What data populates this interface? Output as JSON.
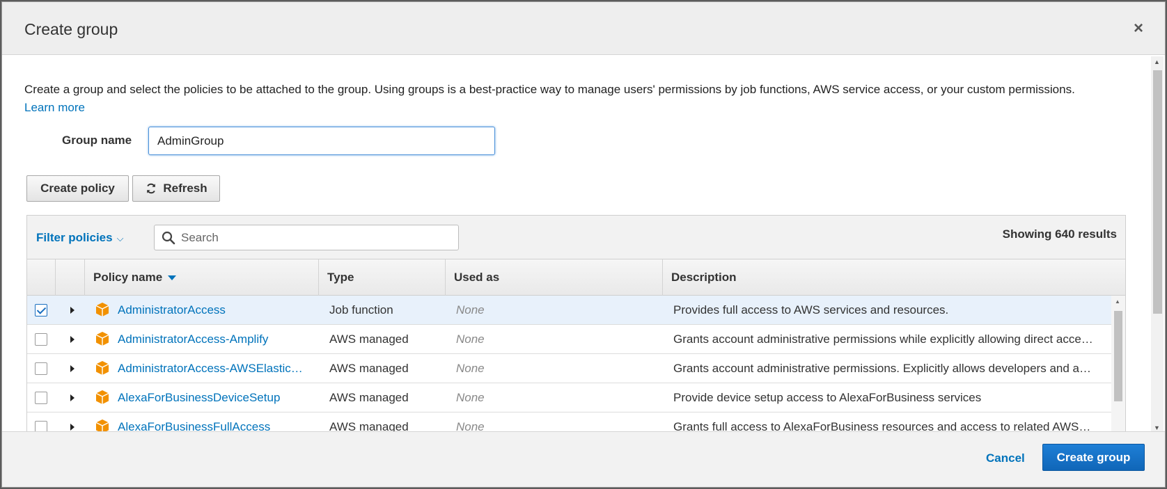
{
  "modal": {
    "title": "Create group",
    "close_symbol": "×"
  },
  "intro": {
    "text": "Create a group and select the policies to be attached to the group. Using groups is a best-practice way to manage users' permissions by job functions, AWS service access, or your custom permissions.",
    "learn_more": "Learn more"
  },
  "group_name": {
    "label": "Group name",
    "value": "AdminGroup"
  },
  "actions": {
    "create_policy": "Create policy",
    "refresh": "Refresh"
  },
  "filter": {
    "label": "Filter policies",
    "search_placeholder": "Search",
    "result_count": "Showing 640 results"
  },
  "table": {
    "columns": [
      "Policy name",
      "Type",
      "Used as",
      "Description"
    ],
    "rows": [
      {
        "name": "AdministratorAccess",
        "type": "Job function",
        "used_as": "None",
        "description": "Provides full access to AWS services and resources.",
        "checked": true
      },
      {
        "name": "AdministratorAccess-Amplify",
        "type": "AWS managed",
        "used_as": "None",
        "description": "Grants account administrative permissions while explicitly allowing direct acce…",
        "checked": false
      },
      {
        "name": "AdministratorAccess-AWSElastic…",
        "type": "AWS managed",
        "used_as": "None",
        "description": "Grants account administrative permissions. Explicitly allows developers and a…",
        "checked": false
      },
      {
        "name": "AlexaForBusinessDeviceSetup",
        "type": "AWS managed",
        "used_as": "None",
        "description": "Provide device setup access to AlexaForBusiness services",
        "checked": false
      },
      {
        "name": "AlexaForBusinessFullAccess",
        "type": "AWS managed",
        "used_as": "None",
        "description": "Grants full access to AlexaForBusiness resources and access to related AWS…",
        "checked": false
      }
    ]
  },
  "footer": {
    "cancel": "Cancel",
    "create_group": "Create group"
  },
  "colors": {
    "link": "#0073bb",
    "primary": "#1066b8",
    "policy_icon": "#f29100",
    "selected_row": "#e8f1fb"
  },
  "icons": {
    "close": "close-icon",
    "refresh": "refresh-icon",
    "search": "search-icon",
    "sort": "sort-descending-icon",
    "policy": "policy-cube-icon",
    "expand": "expand-caret-icon"
  }
}
